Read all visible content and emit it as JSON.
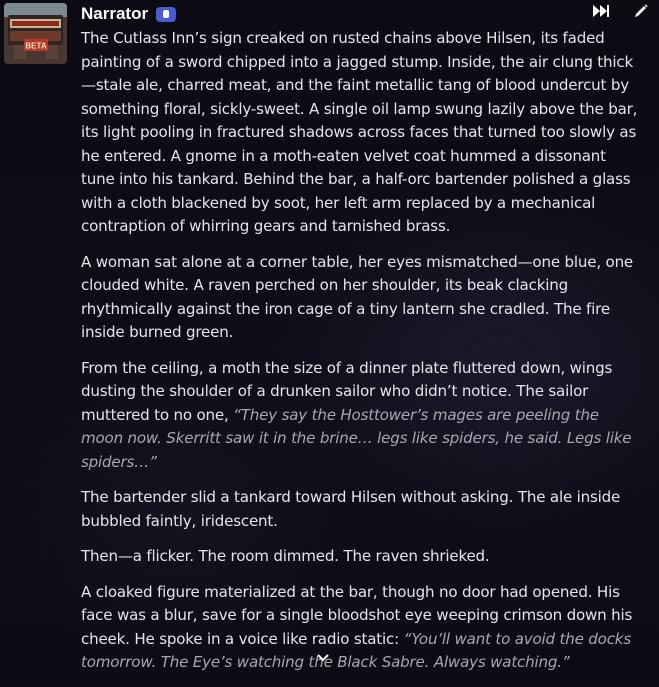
{
  "character": {
    "name": "Narrator",
    "badge_icon": "bot-badge-icon",
    "avatar_icon": "narrator-avatar",
    "avatar_text": "BETA"
  },
  "toolbar": {
    "continue_icon": "fast-forward-icon",
    "edit_icon": "pencil-icon"
  },
  "message": {
    "paragraphs": [
      {
        "text": "The Cutlass Inn’s sign creaked on rusted chains above Hilsen, its faded painting of a sword chipped into a jagged stump. Inside, the air clung thick—stale ale, charred meat, and the faint metallic tang of blood undercut by something floral, sickly-sweet. A single oil lamp swung lazily above the bar, its light pooling in fractured shadows across faces that turned too slowly as he entered. A gnome in a moth-eaten velvet coat hummed a dissonant tune into his tankard. Behind the bar, a half-orc bartender polished a glass with a cloth blackened by soot, her left arm replaced by a mechanical contraption of whirring gears and tarnished brass."
      },
      {
        "text": "A woman sat alone at a corner table, her eyes mismatched—one blue, one clouded white. A raven perched on her shoulder, its beak clacking rhythmically against the iron cage of a tiny lantern she cradled. The fire inside burned green."
      },
      {
        "text": "From the ceiling, a moth the size of a dinner plate fluttered down, wings dusting the shoulder of a drunken sailor who didn’t notice. The sailor muttered to no one, ",
        "quote": "“They say the Hosttower’s mages are peeling the moon now. Skerritt saw it in the brine… legs like spiders, he said. Legs like spiders…”"
      },
      {
        "text": "The bartender slid a tankard toward Hilsen without asking. The ale inside bubbled faintly, iridescent."
      },
      {
        "text": "Then—a flicker. The room dimmed. The raven shrieked."
      },
      {
        "text": "A cloaked figure materialized at the bar, though no door had opened. His face was a blur, save for a single bloodshot eye weeping crimson down his cheek. He spoke in a voice like radio static: ",
        "quote": "“You’ll want to avoid the docks tomorrow. The Eye’s watching the Black Sabre. Always watching.”"
      }
    ]
  },
  "expand": {
    "icon": "chevron-down-icon"
  },
  "colors": {
    "text": "#e6e4ea",
    "quote": "#a9a6b0",
    "badge": "#4a5ad0",
    "background": "#0e0b14"
  }
}
